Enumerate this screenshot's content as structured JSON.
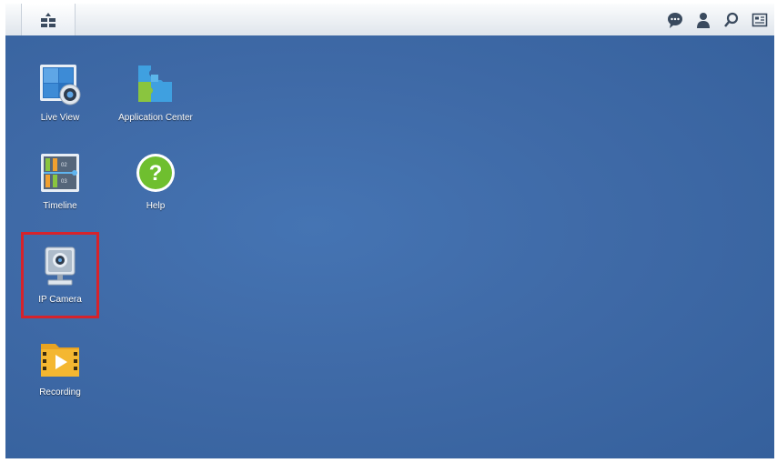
{
  "taskbar": {
    "main_menu_icon": "main-menu-icon",
    "tray_icons": [
      "chat-icon",
      "user-icon",
      "search-icon",
      "widgets-icon"
    ]
  },
  "desktop": {
    "icons": [
      {
        "label": "Live View",
        "icon": "live-view-icon"
      },
      {
        "label": "Application Center",
        "icon": "puzzle-icon"
      },
      {
        "label": "Timeline",
        "icon": "timeline-icon"
      },
      {
        "label": "Help",
        "icon": "help-icon"
      },
      {
        "label": "IP Camera",
        "icon": "ip-camera-icon",
        "highlighted": true
      },
      {
        "label": "Recording",
        "icon": "recording-icon"
      }
    ]
  },
  "timeline_marks": [
    "02",
    "03"
  ],
  "colors": {
    "desktop": "#3f6aa7",
    "highlight": "#d6232b"
  }
}
